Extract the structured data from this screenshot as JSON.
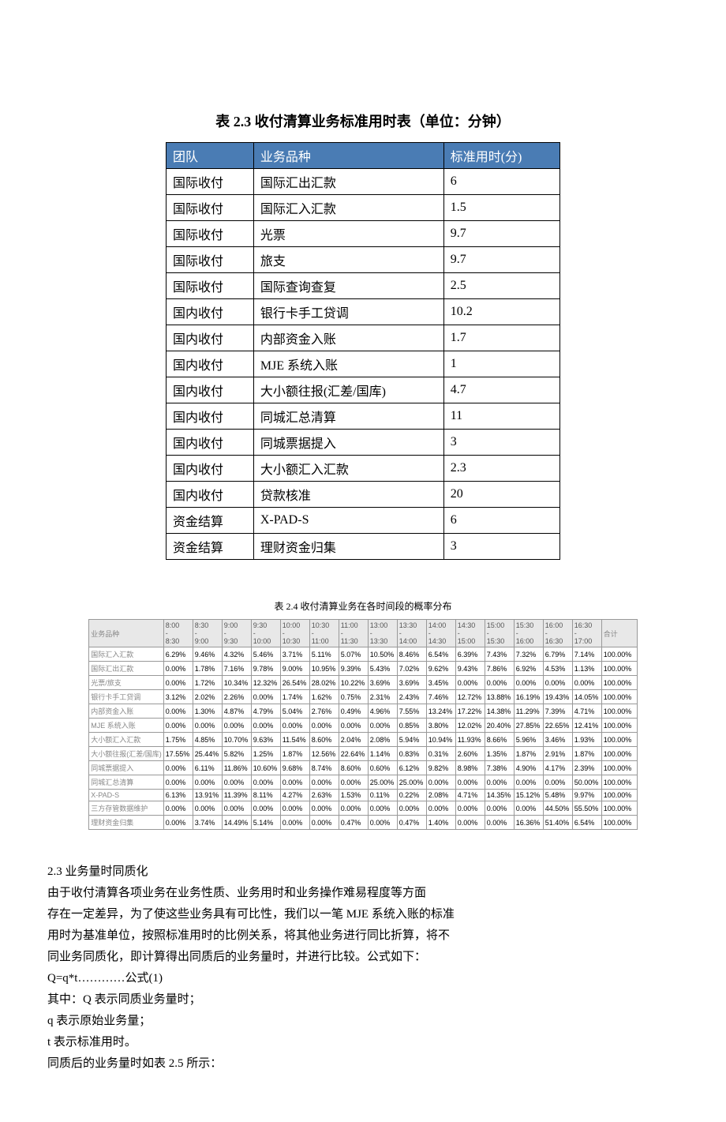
{
  "table23": {
    "title": "表 2.3   收付清算业务标准用时表（单位：分钟）",
    "headers": [
      "团队",
      "业务品种",
      "标准用时(分)"
    ],
    "rows": [
      [
        "国际收付",
        "国际汇出汇款",
        "6"
      ],
      [
        "国际收付",
        "国际汇入汇款",
        "1.5"
      ],
      [
        "国际收付",
        "光票",
        "9.7"
      ],
      [
        "国际收付",
        "旅支",
        "9.7"
      ],
      [
        "国际收付",
        "国际查询查复",
        "2.5"
      ],
      [
        "国内收付",
        "银行卡手工贷调",
        "10.2"
      ],
      [
        "国内收付",
        "内部资金入账",
        "1.7"
      ],
      [
        "国内收付",
        "MJE 系统入账",
        "1"
      ],
      [
        "国内收付",
        "大小额往报(汇差/国库)",
        "4.7"
      ],
      [
        "国内收付",
        "同城汇总清算",
        "11"
      ],
      [
        "国内收付",
        "同城票据提入",
        "3"
      ],
      [
        "国内收付",
        "大小额汇入汇款",
        "2.3"
      ],
      [
        "国内收付",
        "贷款核准",
        "20"
      ],
      [
        "资金结算",
        "X-PAD-S",
        "6"
      ],
      [
        "资金结算",
        "理财资金归集",
        "3"
      ]
    ]
  },
  "table24": {
    "title": "表 2.4   收付清算业务在各时间段的概率分布",
    "row_header": "业务品种",
    "time_headers": [
      {
        "t": "8:00",
        "b": "8:30"
      },
      {
        "t": "8:30",
        "b": "9:00"
      },
      {
        "t": "9:00",
        "b": "9:30"
      },
      {
        "t": "9:30",
        "b": "10:00"
      },
      {
        "t": "10:00",
        "b": "10:30"
      },
      {
        "t": "10:30",
        "b": "11:00"
      },
      {
        "t": "11:00",
        "b": "11:30"
      },
      {
        "t": "13:00",
        "b": "13:30"
      },
      {
        "t": "13:30",
        "b": "14:00"
      },
      {
        "t": "14:00",
        "b": "14:30"
      },
      {
        "t": "14:30",
        "b": "15:00"
      },
      {
        "t": "15:00",
        "b": "15:30"
      },
      {
        "t": "15:30",
        "b": "16:00"
      },
      {
        "t": "16:00",
        "b": "16:30"
      },
      {
        "t": "16:30",
        "b": "17:00"
      }
    ],
    "sum_header": "合计",
    "rows": [
      {
        "label": "国际汇入汇款",
        "v": [
          "6.29%",
          "9.46%",
          "4.32%",
          "5.46%",
          "3.71%",
          "5.11%",
          "5.07%",
          "10.50%",
          "8.46%",
          "6.54%",
          "6.39%",
          "7.43%",
          "7.32%",
          "6.79%",
          "7.14%"
        ],
        "sum": "100.00%"
      },
      {
        "label": "国际汇出汇款",
        "v": [
          "0.00%",
          "1.78%",
          "7.16%",
          "9.78%",
          "9.00%",
          "10.95%",
          "9.39%",
          "5.43%",
          "7.02%",
          "9.62%",
          "9.43%",
          "7.86%",
          "6.92%",
          "4.53%",
          "1.13%"
        ],
        "sum": "100.00%"
      },
      {
        "label": "光票/旅支",
        "v": [
          "0.00%",
          "1.72%",
          "10.34%",
          "12.32%",
          "26.54%",
          "28.02%",
          "10.22%",
          "3.69%",
          "3.69%",
          "3.45%",
          "0.00%",
          "0.00%",
          "0.00%",
          "0.00%",
          "0.00%"
        ],
        "sum": "100.00%"
      },
      {
        "label": "银行卡手工贷调",
        "v": [
          "3.12%",
          "2.02%",
          "2.26%",
          "0.00%",
          "1.74%",
          "1.62%",
          "0.75%",
          "2.31%",
          "2.43%",
          "7.46%",
          "12.72%",
          "13.88%",
          "16.19%",
          "19.43%",
          "14.05%"
        ],
        "sum": "100.00%"
      },
      {
        "label": "内部资金入账",
        "v": [
          "0.00%",
          "1.30%",
          "4.87%",
          "4.79%",
          "5.04%",
          "2.76%",
          "0.49%",
          "4.96%",
          "7.55%",
          "13.24%",
          "17.22%",
          "14.38%",
          "11.29%",
          "7.39%",
          "4.71%"
        ],
        "sum": "100.00%"
      },
      {
        "label": "MJE 系统入账",
        "v": [
          "0.00%",
          "0.00%",
          "0.00%",
          "0.00%",
          "0.00%",
          "0.00%",
          "0.00%",
          "0.00%",
          "0.85%",
          "3.80%",
          "12.02%",
          "20.40%",
          "27.85%",
          "22.65%",
          "12.41%"
        ],
        "sum": "100.00%"
      },
      {
        "label": "大小额汇入汇款",
        "v": [
          "1.75%",
          "4.85%",
          "10.70%",
          "9.63%",
          "11.54%",
          "8.60%",
          "2.04%",
          "2.08%",
          "5.94%",
          "10.94%",
          "11.93%",
          "8.66%",
          "5.96%",
          "3.46%",
          "1.93%"
        ],
        "sum": "100.00%"
      },
      {
        "label": "大小额往报(汇差/国库)",
        "v": [
          "17.55%",
          "25.44%",
          "5.82%",
          "1.25%",
          "1.87%",
          "12.56%",
          "22.64%",
          "1.14%",
          "0.83%",
          "0.31%",
          "2.60%",
          "1.35%",
          "1.87%",
          "2.91%",
          "1.87%"
        ],
        "sum": "100.00%"
      },
      {
        "label": "同城票据提入",
        "v": [
          "0.00%",
          "6.11%",
          "11.86%",
          "10.60%",
          "9.68%",
          "8.74%",
          "8.60%",
          "0.60%",
          "6.12%",
          "9.82%",
          "8.98%",
          "7.38%",
          "4.90%",
          "4.17%",
          "2.39%"
        ],
        "sum": "100.00%"
      },
      {
        "label": "同城汇总清算",
        "v": [
          "0.00%",
          "0.00%",
          "0.00%",
          "0.00%",
          "0.00%",
          "0.00%",
          "0.00%",
          "25.00%",
          "25.00%",
          "0.00%",
          "0.00%",
          "0.00%",
          "0.00%",
          "0.00%",
          "50.00%"
        ],
        "sum": "100.00%"
      },
      {
        "label": "X-PAD-S",
        "v": [
          "6.13%",
          "13.91%",
          "11.39%",
          "8.11%",
          "4.27%",
          "2.63%",
          "1.53%",
          "0.11%",
          "0.22%",
          "2.08%",
          "4.71%",
          "14.35%",
          "15.12%",
          "5.48%",
          "9.97%"
        ],
        "sum": "100.00%"
      },
      {
        "label": "三方存管数据维护",
        "v": [
          "0.00%",
          "0.00%",
          "0.00%",
          "0.00%",
          "0.00%",
          "0.00%",
          "0.00%",
          "0.00%",
          "0.00%",
          "0.00%",
          "0.00%",
          "0.00%",
          "0.00%",
          "44.50%",
          "55.50%"
        ],
        "sum": "100.00%"
      },
      {
        "label": "理财资金归集",
        "v": [
          "0.00%",
          "3.74%",
          "14.49%",
          "5.14%",
          "0.00%",
          "0.00%",
          "0.47%",
          "0.00%",
          "0.47%",
          "1.40%",
          "0.00%",
          "0.00%",
          "16.36%",
          "51.40%",
          "6.54%"
        ],
        "sum": "100.00%"
      }
    ]
  },
  "body": {
    "heading": "2.3 业务量时同质化",
    "p1": "由于收付清算各项业务在业务性质、业务用时和业务操作难易程度等方面",
    "p2": "存在一定差异，为了使这些业务具有可比性，我们以一笔 MJE 系统入账的标准",
    "p3": "用时为基准单位，按照标准用时的比例关系，将其他业务进行同比折算，将不",
    "p4": "同业务同质化，即计算得出同质后的业务量时，并进行比较。公式如下：",
    "p5": "Q=q*t…………公式(1)",
    "p6": "其中：Q 表示同质业务量时；",
    "p7": "q 表示原始业务量；",
    "p8": "t 表示标准用时。",
    "p9": "同质后的业务量时如表 2.5 所示："
  },
  "chart_data": [
    {
      "type": "table",
      "title": "表 2.3 收付清算业务标准用时表（单位：分钟）",
      "columns": [
        "团队",
        "业务品种",
        "标准用时(分)"
      ],
      "rows": [
        [
          "国际收付",
          "国际汇出汇款",
          6
        ],
        [
          "国际收付",
          "国际汇入汇款",
          1.5
        ],
        [
          "国际收付",
          "光票",
          9.7
        ],
        [
          "国际收付",
          "旅支",
          9.7
        ],
        [
          "国际收付",
          "国际查询查复",
          2.5
        ],
        [
          "国内收付",
          "银行卡手工贷调",
          10.2
        ],
        [
          "国内收付",
          "内部资金入账",
          1.7
        ],
        [
          "国内收付",
          "MJE 系统入账",
          1
        ],
        [
          "国内收付",
          "大小额往报(汇差/国库)",
          4.7
        ],
        [
          "国内收付",
          "同城汇总清算",
          11
        ],
        [
          "国内收付",
          "同城票据提入",
          3
        ],
        [
          "国内收付",
          "大小额汇入汇款",
          2.3
        ],
        [
          "国内收付",
          "贷款核准",
          20
        ],
        [
          "资金结算",
          "X-PAD-S",
          6
        ],
        [
          "资金结算",
          "理财资金归集",
          3
        ]
      ]
    },
    {
      "type": "table",
      "title": "表 2.4 收付清算业务在各时间段的概率分布",
      "columns": [
        "业务品种",
        "8:00-8:30",
        "8:30-9:00",
        "9:00-9:30",
        "9:30-10:00",
        "10:00-10:30",
        "10:30-11:00",
        "11:00-11:30",
        "13:00-13:30",
        "13:30-14:00",
        "14:00-14:30",
        "14:30-15:00",
        "15:00-15:30",
        "15:30-16:00",
        "16:00-16:30",
        "16:30-17:00",
        "合计"
      ],
      "rows": [
        [
          "国际汇入汇款",
          6.29,
          9.46,
          4.32,
          5.46,
          3.71,
          5.11,
          5.07,
          10.5,
          8.46,
          6.54,
          6.39,
          7.43,
          7.32,
          6.79,
          7.14,
          100.0
        ],
        [
          "国际汇出汇款",
          0.0,
          1.78,
          7.16,
          9.78,
          9.0,
          10.95,
          9.39,
          5.43,
          7.02,
          9.62,
          9.43,
          7.86,
          6.92,
          4.53,
          1.13,
          100.0
        ],
        [
          "光票/旅支",
          0.0,
          1.72,
          10.34,
          12.32,
          26.54,
          28.02,
          10.22,
          3.69,
          3.69,
          3.45,
          0.0,
          0.0,
          0.0,
          0.0,
          0.0,
          100.0
        ],
        [
          "银行卡手工贷调",
          3.12,
          2.02,
          2.26,
          0.0,
          1.74,
          1.62,
          0.75,
          2.31,
          2.43,
          7.46,
          12.72,
          13.88,
          16.19,
          19.43,
          14.05,
          100.0
        ],
        [
          "内部资金入账",
          0.0,
          1.3,
          4.87,
          4.79,
          5.04,
          2.76,
          0.49,
          4.96,
          7.55,
          13.24,
          17.22,
          14.38,
          11.29,
          7.39,
          4.71,
          100.0
        ],
        [
          "MJE 系统入账",
          0.0,
          0.0,
          0.0,
          0.0,
          0.0,
          0.0,
          0.0,
          0.0,
          0.85,
          3.8,
          12.02,
          20.4,
          27.85,
          22.65,
          12.41,
          100.0
        ],
        [
          "大小额汇入汇款",
          1.75,
          4.85,
          10.7,
          9.63,
          11.54,
          8.6,
          2.04,
          2.08,
          5.94,
          10.94,
          11.93,
          8.66,
          5.96,
          3.46,
          1.93,
          100.0
        ],
        [
          "大小额往报(汇差/国库)",
          17.55,
          25.44,
          5.82,
          1.25,
          1.87,
          12.56,
          22.64,
          1.14,
          0.83,
          0.31,
          2.6,
          1.35,
          1.87,
          2.91,
          1.87,
          100.0
        ],
        [
          "同城票据提入",
          0.0,
          6.11,
          11.86,
          10.6,
          9.68,
          8.74,
          8.6,
          0.6,
          6.12,
          9.82,
          8.98,
          7.38,
          4.9,
          4.17,
          2.39,
          100.0
        ],
        [
          "同城汇总清算",
          0.0,
          0.0,
          0.0,
          0.0,
          0.0,
          0.0,
          0.0,
          25.0,
          25.0,
          0.0,
          0.0,
          0.0,
          0.0,
          0.0,
          50.0,
          100.0
        ],
        [
          "X-PAD-S",
          6.13,
          13.91,
          11.39,
          8.11,
          4.27,
          2.63,
          1.53,
          0.11,
          0.22,
          2.08,
          4.71,
          14.35,
          15.12,
          5.48,
          9.97,
          100.0
        ],
        [
          "三方存管数据维护",
          0.0,
          0.0,
          0.0,
          0.0,
          0.0,
          0.0,
          0.0,
          0.0,
          0.0,
          0.0,
          0.0,
          0.0,
          0.0,
          44.5,
          55.5,
          100.0
        ],
        [
          "理财资金归集",
          0.0,
          3.74,
          14.49,
          5.14,
          0.0,
          0.0,
          0.47,
          0.0,
          0.47,
          1.4,
          0.0,
          0.0,
          16.36,
          51.4,
          6.54,
          100.0
        ]
      ]
    }
  ]
}
